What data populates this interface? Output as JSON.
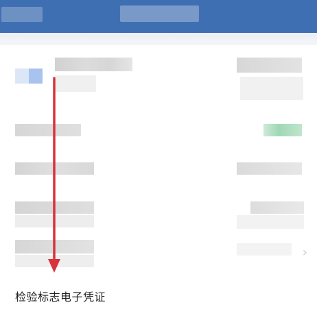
{
  "footer": {
    "voucher_label": "检验标志电子凭证"
  },
  "icons": {
    "chevron": "chevron-right-icon",
    "arrow": "arrow-down-icon"
  },
  "colors": {
    "header": "#3f6fb3",
    "arrow": "#d8323c",
    "accent_green": "#9fd8b6"
  }
}
